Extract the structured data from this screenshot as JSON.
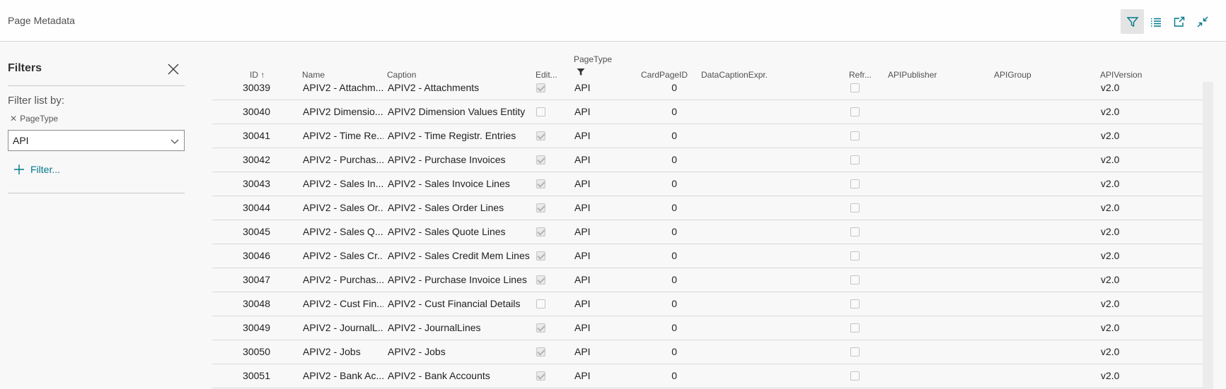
{
  "header": {
    "title": "Page Metadata",
    "actions": [
      {
        "name": "filter-pane-button",
        "icon": "filter-icon"
      },
      {
        "name": "list-view-button",
        "icon": "list-icon"
      },
      {
        "name": "open-new-window-button",
        "icon": "open-new-window-icon"
      },
      {
        "name": "collapse-button",
        "icon": "collapse-icon"
      }
    ]
  },
  "filter_pane": {
    "title": "Filters",
    "filter_list_by": "Filter list by:",
    "field_label": "PageType",
    "field_value": "API",
    "add_filter": "Filter..."
  },
  "table": {
    "columns": [
      "ID",
      "Name",
      "Caption",
      "Edit...",
      "PageType",
      "CardPageID",
      "DataCaptionExpr.",
      "Refr...",
      "APIPublisher",
      "APIGroup",
      "APIVersion"
    ],
    "sort_arrow": "↑",
    "rows": [
      {
        "id": "30039",
        "name": "APIV2 - Attachm...",
        "caption": "APIV2 - Attachments",
        "editable": true,
        "pagetype": "API",
        "cardpageid": "0",
        "refresh": false,
        "version": "v2.0"
      },
      {
        "id": "30040",
        "name": "APIV2 Dimensio...",
        "caption": "APIV2 Dimension Values Entity",
        "editable": false,
        "pagetype": "API",
        "cardpageid": "0",
        "refresh": false,
        "version": "v2.0"
      },
      {
        "id": "30041",
        "name": "APIV2 - Time Re...",
        "caption": "APIV2 - Time Registr. Entries",
        "editable": true,
        "pagetype": "API",
        "cardpageid": "0",
        "refresh": false,
        "version": "v2.0"
      },
      {
        "id": "30042",
        "name": "APIV2 - Purchas...",
        "caption": "APIV2 - Purchase Invoices",
        "editable": true,
        "pagetype": "API",
        "cardpageid": "0",
        "refresh": false,
        "version": "v2.0"
      },
      {
        "id": "30043",
        "name": "APIV2 - Sales In...",
        "caption": "APIV2 - Sales Invoice Lines",
        "editable": true,
        "pagetype": "API",
        "cardpageid": "0",
        "refresh": false,
        "version": "v2.0"
      },
      {
        "id": "30044",
        "name": "APIV2 - Sales Or...",
        "caption": "APIV2 - Sales Order Lines",
        "editable": true,
        "pagetype": "API",
        "cardpageid": "0",
        "refresh": false,
        "version": "v2.0"
      },
      {
        "id": "30045",
        "name": "APIV2 - Sales Q...",
        "caption": "APIV2 - Sales Quote Lines",
        "editable": true,
        "pagetype": "API",
        "cardpageid": "0",
        "refresh": false,
        "version": "v2.0"
      },
      {
        "id": "30046",
        "name": "APIV2 - Sales Cr...",
        "caption": "APIV2 - Sales Credit Mem Lines",
        "editable": true,
        "pagetype": "API",
        "cardpageid": "0",
        "refresh": false,
        "version": "v2.0"
      },
      {
        "id": "30047",
        "name": "APIV2 - Purchas...",
        "caption": "APIV2 - Purchase Invoice Lines",
        "editable": true,
        "pagetype": "API",
        "cardpageid": "0",
        "refresh": false,
        "version": "v2.0"
      },
      {
        "id": "30048",
        "name": "APIV2 - Cust Fin...",
        "caption": "APIV2 - Cust Financial Details",
        "editable": false,
        "pagetype": "API",
        "cardpageid": "0",
        "refresh": false,
        "version": "v2.0"
      },
      {
        "id": "30049",
        "name": "APIV2 - JournalL...",
        "caption": "APIV2 - JournalLines",
        "editable": true,
        "pagetype": "API",
        "cardpageid": "0",
        "refresh": false,
        "version": "v2.0"
      },
      {
        "id": "30050",
        "name": "APIV2 - Jobs",
        "caption": "APIV2 - Jobs",
        "editable": true,
        "pagetype": "API",
        "cardpageid": "0",
        "refresh": false,
        "version": "v2.0"
      },
      {
        "id": "30051",
        "name": "APIV2 - Bank Ac...",
        "caption": "APIV2 - Bank Accounts",
        "editable": true,
        "pagetype": "API",
        "cardpageid": "0",
        "refresh": false,
        "version": "v2.0"
      }
    ]
  },
  "colors": {
    "accent": "#00788a",
    "background": "#f8f8f8",
    "divider": "#d9d9d9"
  }
}
